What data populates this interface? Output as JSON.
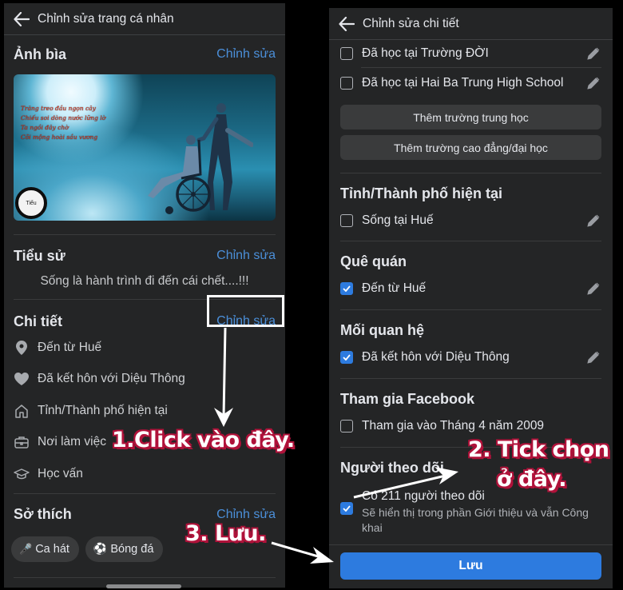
{
  "left": {
    "title": "Chỉnh sửa trang cá nhân",
    "cover": {
      "heading": "Ảnh bìa",
      "edit": "Chỉnh sửa",
      "poem_lines": [
        "Trăng treo đầu ngọn cây",
        "Chiếu soi dòng nước lững lờ",
        "Ta ngồi đây chờ",
        "Cõi mộng hoài sầu vương"
      ],
      "logo_text": "Tiểu"
    },
    "bio": {
      "heading": "Tiểu sử",
      "edit": "Chỉnh sửa",
      "text": "Sống là hành trình đi đến cái chết....!!!"
    },
    "details": {
      "heading": "Chi tiết",
      "edit": "Chỉnh sửa",
      "items": [
        {
          "icon": "location-pin-icon",
          "label": "Đến từ Huế"
        },
        {
          "icon": "heart-icon",
          "label": "Đã kết hôn với Diệu Thông"
        },
        {
          "icon": "home-icon",
          "label": "Tỉnh/Thành phố hiện tại"
        },
        {
          "icon": "briefcase-icon",
          "label": "Nơi làm việc"
        },
        {
          "icon": "graduation-cap-icon",
          "label": "Học vấn"
        }
      ]
    },
    "hobbies": {
      "heading": "Sở thích",
      "edit": "Chỉnh sửa",
      "chips": [
        {
          "icon": "microphone-icon",
          "glyph": "🎤",
          "label": "Ca hát"
        },
        {
          "icon": "soccer-ball-icon",
          "glyph": "⚽",
          "label": "Bóng đá"
        }
      ]
    }
  },
  "right": {
    "title": "Chỉnh sửa chi tiết",
    "education": [
      {
        "label": "Đã học tại Trường ĐỜI",
        "checked": false
      },
      {
        "label": "Đã học tại Hai Ba Trung High School",
        "checked": false
      }
    ],
    "add_high_school": "Thêm trường trung học",
    "add_college": "Thêm trường cao đẳng/đại học",
    "current_city": {
      "heading": "Tỉnh/Thành phố hiện tại",
      "label": "Sống tại Huế",
      "checked": false
    },
    "hometown": {
      "heading": "Quê quán",
      "label": "Đến từ Huế",
      "checked": true
    },
    "relationship": {
      "heading": "Mối quan hệ",
      "label": "Đã kết hôn với Diệu Thông",
      "checked": true
    },
    "joined": {
      "heading": "Tham gia Facebook",
      "label": "Tham gia vào Tháng 4 năm 2009",
      "checked": false
    },
    "followers": {
      "heading": "Người theo dõi",
      "label": "Có 211 người theo dõi",
      "sub": "Sẽ hiển thị trong phần Giới thiệu và vẫn Công khai",
      "checked": true
    },
    "save": "Lưu"
  },
  "annotations": {
    "step1": "1.Click vào đây.",
    "step2_line1": "2. Tick chọn",
    "step2_line2": "ở đây.",
    "step3": "3. Lưu."
  },
  "colors": {
    "panel_bg": "#242526",
    "accent_link": "#4b8fd9",
    "checkbox_blue": "#2d7bdf",
    "save_button": "#2d7bdf",
    "annotation_outline": "#b0123a"
  }
}
